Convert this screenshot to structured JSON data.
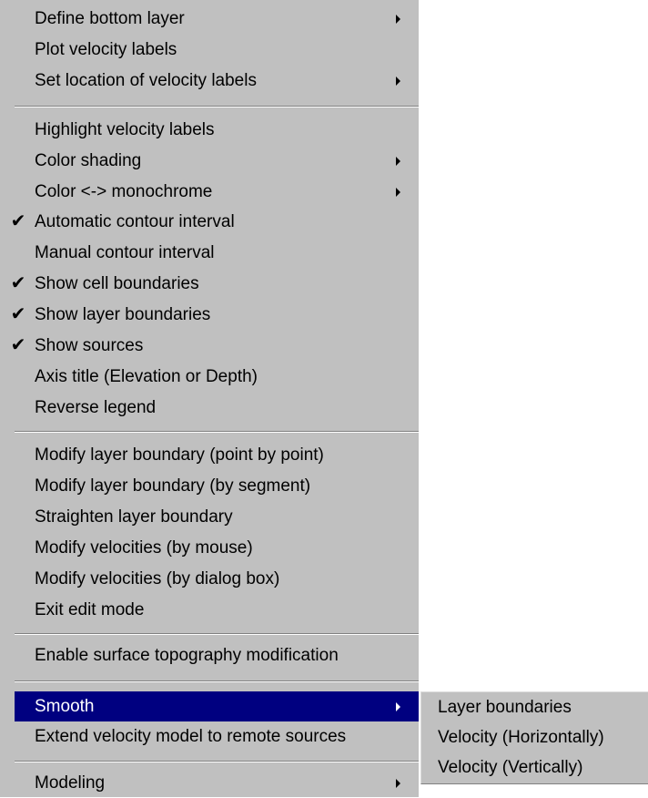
{
  "menu": {
    "items": [
      {
        "label": "Define bottom layer",
        "checked": false,
        "submenu": true
      },
      {
        "label": "Plot velocity labels",
        "checked": false,
        "submenu": false
      },
      {
        "label": "Set location of velocity labels",
        "checked": false,
        "submenu": true
      },
      {
        "label": "Highlight velocity labels",
        "checked": false,
        "submenu": false
      },
      {
        "label": "Color shading",
        "checked": false,
        "submenu": true
      },
      {
        "label": "Color <-> monochrome",
        "checked": false,
        "submenu": true
      },
      {
        "label": "Automatic contour interval",
        "checked": true,
        "submenu": false
      },
      {
        "label": "Manual contour interval",
        "checked": false,
        "submenu": false
      },
      {
        "label": "Show cell boundaries",
        "checked": true,
        "submenu": false
      },
      {
        "label": "Show layer boundaries",
        "checked": true,
        "submenu": false
      },
      {
        "label": "Show sources",
        "checked": true,
        "submenu": false
      },
      {
        "label": "Axis title (Elevation or Depth)",
        "checked": false,
        "submenu": false
      },
      {
        "label": "Reverse legend",
        "checked": false,
        "submenu": false
      },
      {
        "label": "Modify layer boundary (point by point)",
        "checked": false,
        "submenu": false
      },
      {
        "label": "Modify layer boundary (by segment)",
        "checked": false,
        "submenu": false
      },
      {
        "label": "Straighten layer boundary",
        "checked": false,
        "submenu": false
      },
      {
        "label": "Modify velocities (by mouse)",
        "checked": false,
        "submenu": false
      },
      {
        "label": "Modify velocities (by dialog box)",
        "checked": false,
        "submenu": false
      },
      {
        "label": "Exit edit mode",
        "checked": false,
        "submenu": false
      },
      {
        "label": "Enable surface topography modification",
        "checked": false,
        "submenu": false
      },
      {
        "label": "Smooth",
        "checked": false,
        "submenu": true,
        "active": true
      },
      {
        "label": "Extend velocity model to remote sources",
        "checked": false,
        "submenu": false
      },
      {
        "label": "Modeling",
        "checked": false,
        "submenu": true
      }
    ]
  },
  "submenu": {
    "items": [
      {
        "label": "Layer boundaries"
      },
      {
        "label": "Velocity (Horizontally)"
      },
      {
        "label": "Velocity (Vertically)"
      }
    ]
  },
  "colors": {
    "menu_background": "#c0c0c0",
    "highlight": "#000080",
    "highlight_text": "#ffffff",
    "separator_dark": "#808080",
    "separator_light": "#ffffff"
  },
  "icons": {
    "check": "check-icon",
    "submenu_arrow": "submenu-arrow-icon"
  }
}
